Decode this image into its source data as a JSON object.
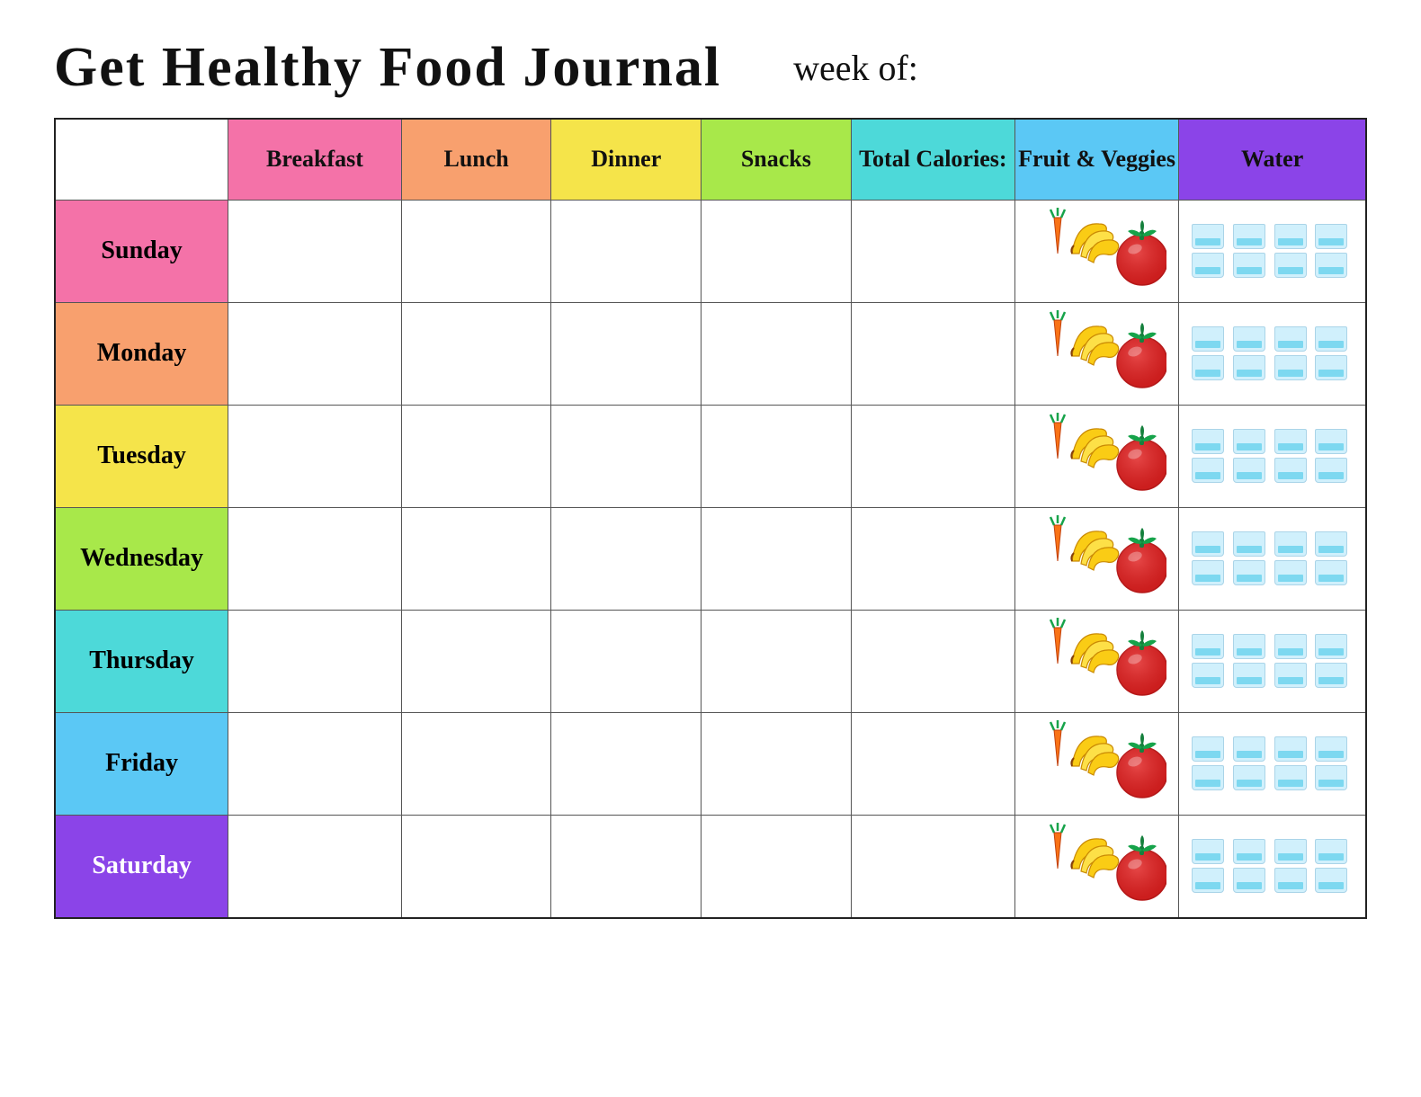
{
  "header": {
    "title": "Get Healthy Food Journal",
    "week_label": "week of:"
  },
  "columns": {
    "day": "",
    "breakfast": "Breakfast",
    "lunch": "Lunch",
    "dinner": "Dinner",
    "snacks": "Snacks",
    "calories": "Total Calories:",
    "fruit": "Fruit & Veggies",
    "water": "Water"
  },
  "days": [
    {
      "name": "Sunday",
      "class": "day-sunday"
    },
    {
      "name": "Monday",
      "class": "day-monday"
    },
    {
      "name": "Tuesday",
      "class": "day-tuesday"
    },
    {
      "name": "Wednesday",
      "class": "day-wednesday"
    },
    {
      "name": "Thursday",
      "class": "day-thursday"
    },
    {
      "name": "Friday",
      "class": "day-friday"
    },
    {
      "name": "Saturday",
      "class": "day-saturday"
    }
  ],
  "water_glasses_count": 8,
  "colors": {
    "breakfast": "#f472a8",
    "lunch": "#f8a06e",
    "dinner": "#f5e44a",
    "snacks": "#a8e84a",
    "calories": "#4dd9d9",
    "fruit": "#5bc8f5",
    "water": "#8b44e8"
  }
}
